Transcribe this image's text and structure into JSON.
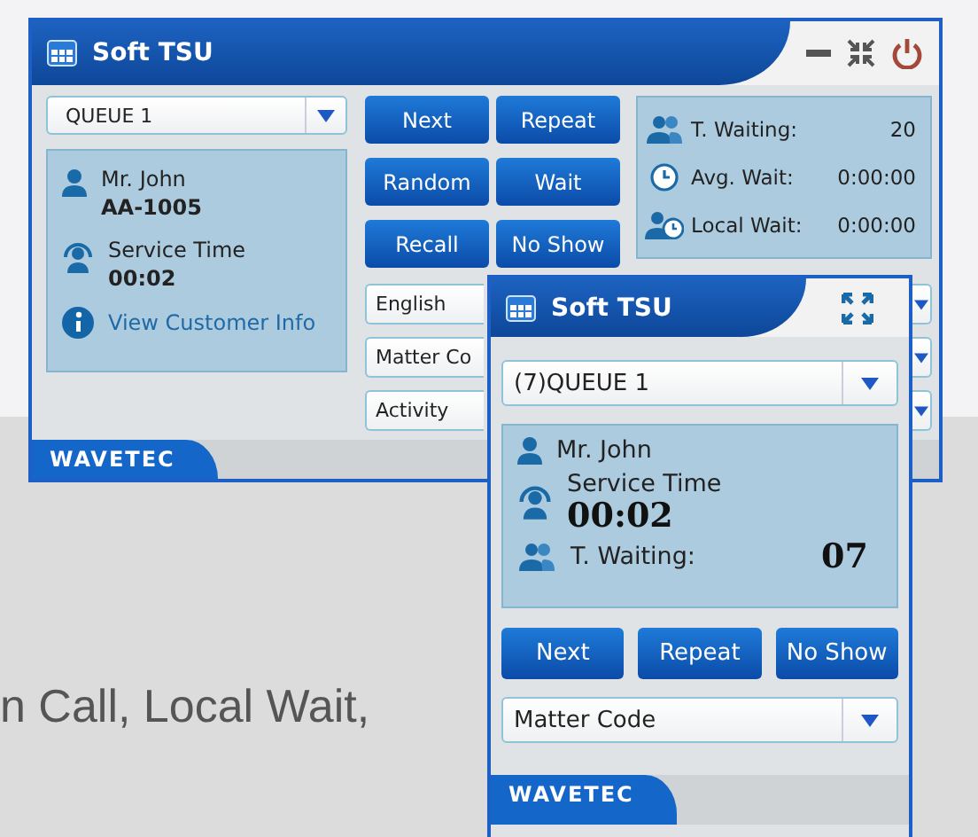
{
  "page_text": "n Call, Local Wait,",
  "main_window": {
    "title": "Soft TSU",
    "queue_select": {
      "value": "QUEUE 1"
    },
    "customer": {
      "name": "Mr. John",
      "ticket": "AA-1005"
    },
    "service": {
      "label": "Service Time",
      "time": "00:02"
    },
    "info_link": "View Customer Info",
    "buttons": [
      "Next",
      "Repeat",
      "Random",
      "Wait",
      "Recall",
      "No Show"
    ],
    "stats": [
      {
        "kind": "people",
        "label": "T. Waiting:",
        "value": "20"
      },
      {
        "kind": "clock",
        "label": "Avg. Wait:",
        "value": "0:00:00"
      },
      {
        "kind": "people-clock",
        "label": "Local Wait:",
        "value": "0:00:00"
      }
    ],
    "selects": [
      {
        "value": "English"
      },
      {
        "value": "Matter Co"
      },
      {
        "value": "Activity"
      }
    ],
    "brand": "WAVETEC"
  },
  "mini_window": {
    "title": "Soft TSU",
    "queue_select": {
      "value": "(7)QUEUE 1"
    },
    "customer": {
      "name": "Mr. John"
    },
    "service": {
      "label": "Service Time",
      "time": "00:02"
    },
    "waiting": {
      "label": "T. Waiting:",
      "value": "07"
    },
    "buttons": [
      "Next",
      "Repeat",
      "No Show"
    ],
    "select": {
      "value": "Matter Code"
    },
    "brand": "WAVETEC"
  }
}
